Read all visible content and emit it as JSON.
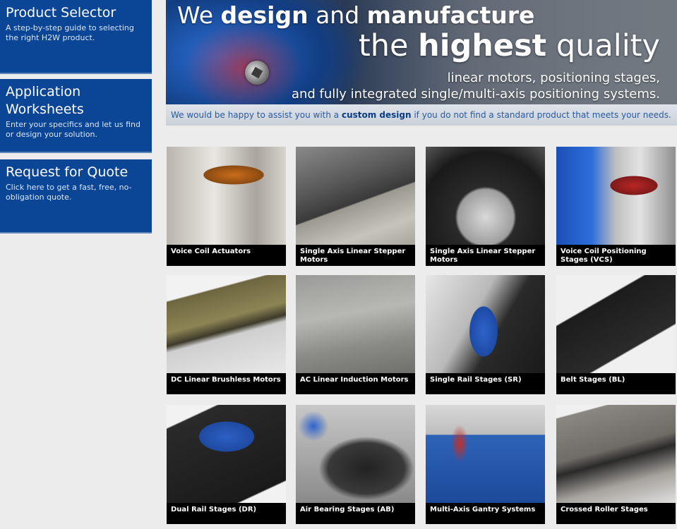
{
  "sidebar": {
    "panels": [
      {
        "title": "Product Selector",
        "desc": "A step-by-step guide to selecting the right H2W product."
      },
      {
        "title": "Application Worksheets",
        "desc": "Enter your specifics and let us find or design your solution."
      },
      {
        "title": "Request for Quote",
        "desc": "Click here to get a fast, free, no-obligation quote."
      }
    ]
  },
  "banner": {
    "l1_a": "We ",
    "l1_b": "design",
    "l1_c": " and ",
    "l1_d": "manufacture",
    "l2_a": "the ",
    "l2_b": "highest",
    "l2_c": " quality",
    "l3": "linear motors, positioning stages,",
    "l4": "and fully integrated single/multi-axis positioning systems.",
    "strip_a": "We would be happy to assist you with a ",
    "strip_b": "custom design",
    "strip_c": " if you do not find a standard product that meets your needs."
  },
  "products": [
    {
      "label": "Voice Coil Actuators"
    },
    {
      "label": "Single Axis Linear Stepper Motors"
    },
    {
      "label": "Single Axis Linear Stepper Motors"
    },
    {
      "label": "Voice Coil Positioning Stages (VCS)"
    },
    {
      "label": "DC Linear Brushless Motors"
    },
    {
      "label": "AC Linear Induction Motors"
    },
    {
      "label": "Single Rail Stages (SR)"
    },
    {
      "label": "Belt Stages (BL)"
    },
    {
      "label": "Dual Rail Stages (DR)"
    },
    {
      "label": "Air Bearing Stages (AB)"
    },
    {
      "label": "Multi-Axis Gantry Systems"
    },
    {
      "label": "Crossed Roller Stages"
    }
  ]
}
